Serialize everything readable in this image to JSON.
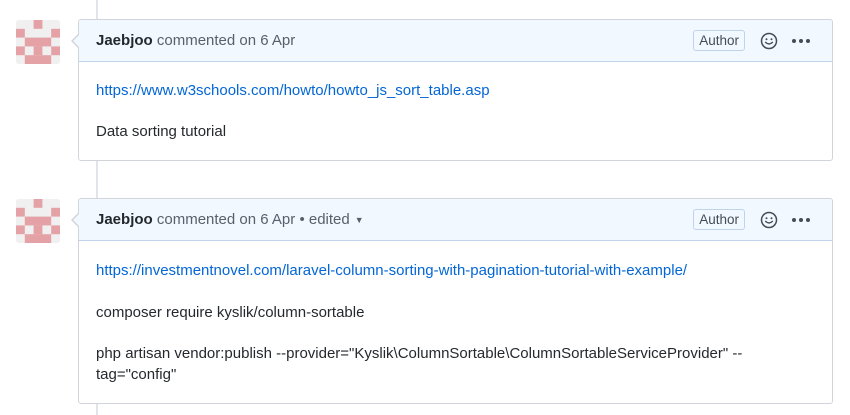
{
  "comments": [
    {
      "author": "Jaebjoo",
      "meta": "commented on 6 Apr",
      "edited": "",
      "badge": "Author",
      "body": {
        "link": "https://www.w3schools.com/howto/howto_js_sort_table.asp",
        "lines": [
          "Data sorting tutorial"
        ]
      }
    },
    {
      "author": "Jaebjoo",
      "meta": "commented on 6 Apr",
      "edited": "• edited",
      "badge": "Author",
      "body": {
        "link": "https://investmentnovel.com/laravel-column-sorting-with-pagination-tutorial-with-example/",
        "lines": [
          "composer require kyslik/column-sortable",
          "php artisan vendor:publish --provider=\"Kyslik\\ColumnSortable\\ColumnSortableServiceProvider\" --tag=\"config\""
        ]
      }
    }
  ],
  "icons": {
    "avatar": "identicon-avatar",
    "reaction": "smiley-icon",
    "more": "kebab-horizontal-icon",
    "edited_caret": "triangle-down-icon"
  },
  "colors": {
    "link": "#0366d6",
    "header_bg": "#f1f8ff",
    "identicon": "#e4a1a6"
  }
}
